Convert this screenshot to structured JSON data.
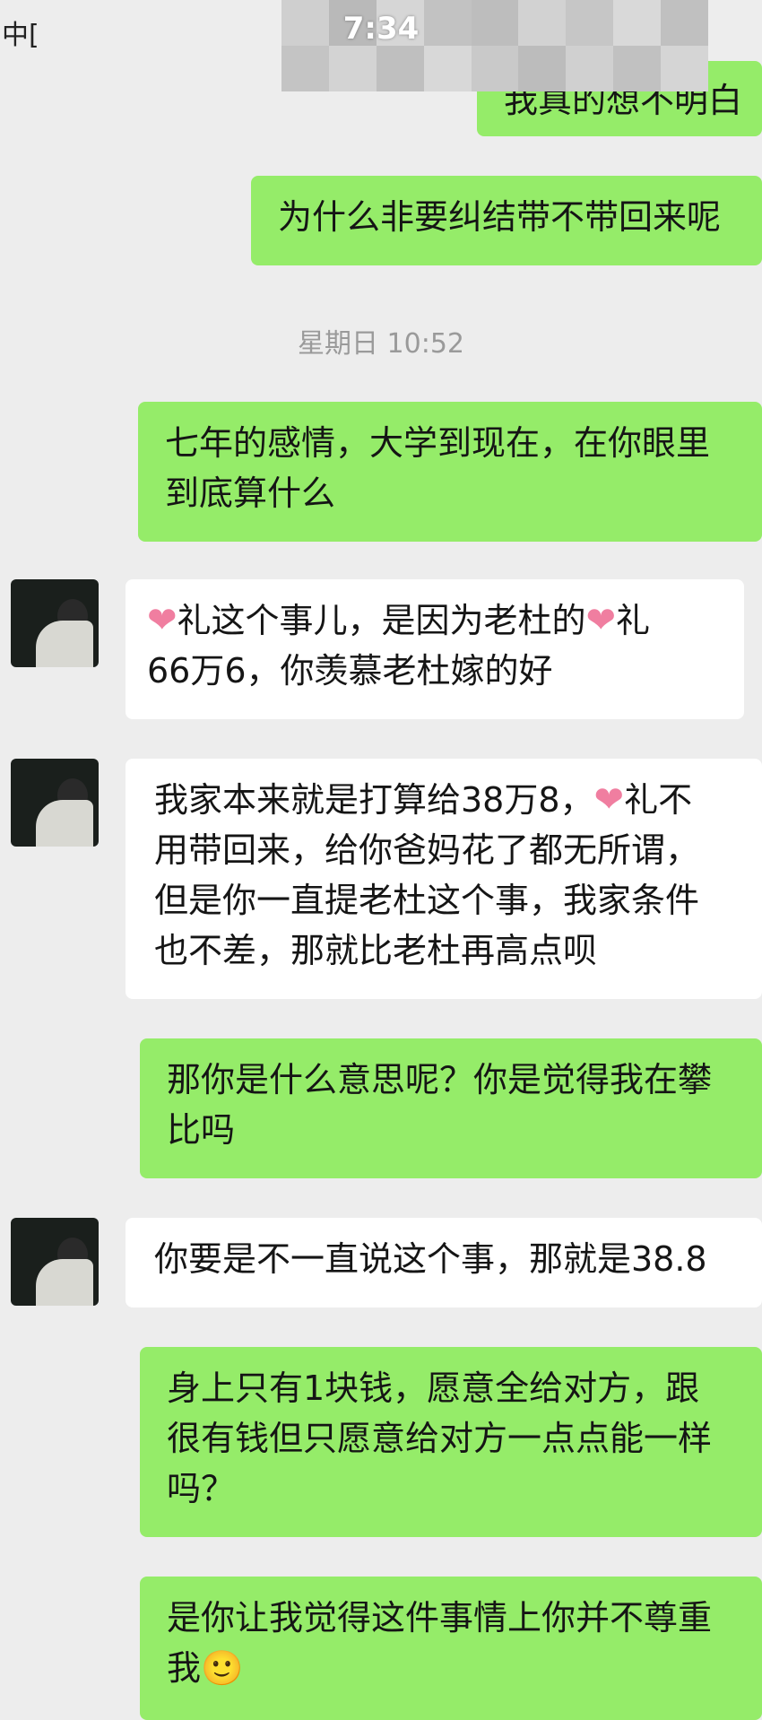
{
  "status": {
    "time": "7:34",
    "left_fragment": "中["
  },
  "colors": {
    "me_bubble": "#95ec69",
    "other_bubble": "#ffffff",
    "background": "#ededed"
  },
  "timestamp": "星期日 10:52",
  "messages": [
    {
      "from": "me",
      "lines": [
        "我真的想不明白"
      ]
    },
    {
      "from": "me",
      "lines": [
        "为什么非要纠结带不带回来呢"
      ]
    },
    {
      "from": "me",
      "lines": [
        "七年的感情，大学到现在，在你眼里",
        "到底算什么"
      ]
    },
    {
      "from": "other",
      "lines": [
        "礼这个事儿，是因为老杜的",
        "礼",
        "66万6，你羡慕老杜嫁的好"
      ]
    },
    {
      "from": "other",
      "lines": [
        "我家本来就是打算给38万8，",
        "礼不",
        "用带回来，给你爸妈花了都无所谓，",
        "但是你一直提老杜这个事，我家条件",
        "也不差，那就比老杜再高点呗"
      ]
    },
    {
      "from": "me",
      "lines": [
        "那你是什么意思呢？你是觉得我在攀",
        "比吗"
      ]
    },
    {
      "from": "other",
      "lines": [
        "你要是不一直说这个事，那就是38.8"
      ]
    },
    {
      "from": "me",
      "lines": [
        "身上只有1块钱，愿意全给对方，跟",
        "很有钱但只愿意给对方一点点能一样",
        "吗？"
      ]
    },
    {
      "from": "me",
      "lines": [
        "是你让我觉得这件事情上你并不尊重",
        "我🙂"
      ]
    }
  ],
  "icons": {
    "heart_sticker": "heart-icon",
    "smile_emoji": "smile-emoji-icon"
  }
}
